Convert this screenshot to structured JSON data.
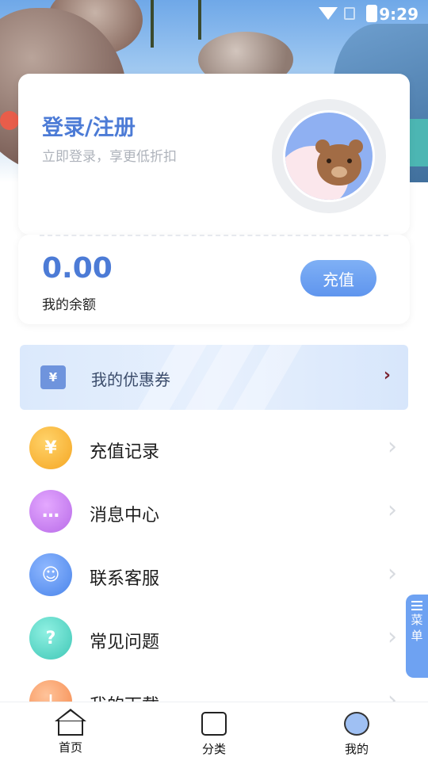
{
  "status_bar": {
    "time": "9:29"
  },
  "login": {
    "title": "登录/注册",
    "subtitle": "立即登录，享更低折扣"
  },
  "balance": {
    "value": "0.00",
    "label": "我的余额",
    "recharge_label": "充值"
  },
  "coupon": {
    "icon_text": "¥",
    "label": "我的优惠券",
    "arrow": "›"
  },
  "menu": [
    {
      "label": "充值记录",
      "icon": "money-bag-icon",
      "color": "#f7b531"
    },
    {
      "label": "消息中心",
      "icon": "message-icon",
      "color": "#c57ef0"
    },
    {
      "label": "联系客服",
      "icon": "headset-icon",
      "color": "#5f95ee"
    },
    {
      "label": "常见问题",
      "icon": "question-icon",
      "color": "#4fd3c4"
    },
    {
      "label": "我的下载",
      "icon": "download-cloud-icon",
      "color": "#f79a5c"
    }
  ],
  "float_menu": {
    "label": "菜单"
  },
  "bottom_nav": [
    {
      "label": "首页",
      "icon": "home-icon"
    },
    {
      "label": "分类",
      "icon": "category-icon"
    },
    {
      "label": "我的",
      "icon": "profile-icon"
    }
  ],
  "colors": {
    "accent": "#4c7bd6",
    "button": "#6ea2f2"
  }
}
